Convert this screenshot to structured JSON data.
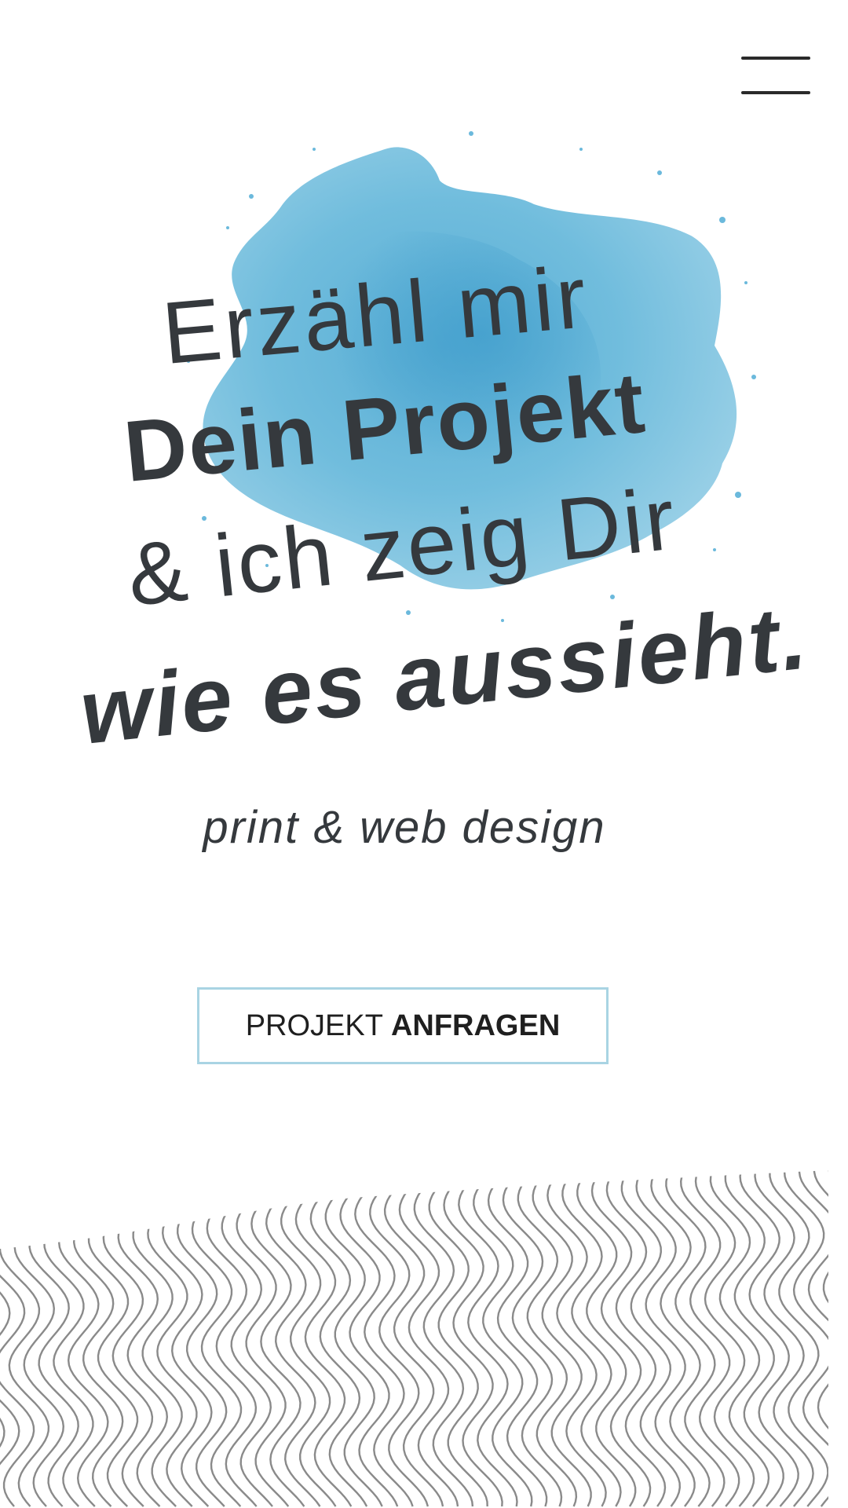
{
  "menu": {
    "icon": "hamburger-menu-icon"
  },
  "hero": {
    "line1": "Erzähl mir",
    "line2": "Dein Projekt",
    "line3": "& ich zeig Dir",
    "line4": "wie es aussieht.",
    "subtitle": "print & web design"
  },
  "cta": {
    "label_regular": "PROJEKT",
    "label_bold": "ANFRAGEN"
  },
  "colors": {
    "text": "#35393d",
    "splash": "#5fb3d6",
    "button_border": "#a9d4e3",
    "waves": "#8a8a8a"
  }
}
